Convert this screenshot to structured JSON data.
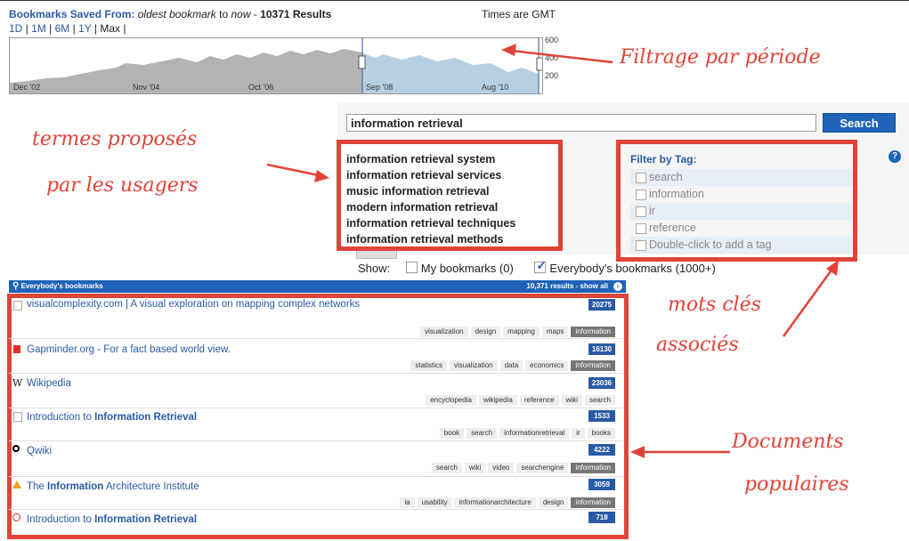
{
  "header": {
    "prefix": "Bookmarks Saved From:",
    "range_text": "oldest bookmark",
    "mid": "to",
    "now": "now",
    "dash": "-",
    "results": "10371 Results",
    "times": "Times are GMT"
  },
  "ranges": [
    "1D",
    "1M",
    "6M",
    "1Y",
    "Max"
  ],
  "timeline": {
    "y_ticks": [
      "600",
      "400",
      "200"
    ],
    "x_ticks": [
      "Dec '02",
      "Nov '04",
      "Oct '06",
      "Sep '08",
      "Aug '10"
    ]
  },
  "search": {
    "value": "information retrieval",
    "button": "Search"
  },
  "suggestions": [
    "information retrieval system",
    "information retrieval services",
    "music information retrieval",
    "modern information retrieval",
    "information retrieval techniques",
    "information retrieval methods"
  ],
  "filter": {
    "title": "Filter by Tag:",
    "help": "?",
    "tags": [
      "search",
      "information",
      "ir",
      "reference",
      "Double-click to add a tag"
    ]
  },
  "show": {
    "label": "Show:",
    "mine": "My bookmarks (0)",
    "everyone": "Everybody's bookmarks (1000+)"
  },
  "results_bar": {
    "title": "Everybody's bookmarks",
    "count": "10,371 results - show all"
  },
  "results": [
    {
      "title": "visualcomplexity.com | A visual exploration on mapping complex networks",
      "count": "20275",
      "tags": [
        "visualization",
        "design",
        "mapping",
        "maps",
        "information"
      ]
    },
    {
      "title": "Gapminder.org - For a fact based world view.",
      "count": "16130",
      "tags": [
        "statistics",
        "visualization",
        "data",
        "economics",
        "information"
      ]
    },
    {
      "title": "Wikipedia",
      "count": "23036",
      "tags": [
        "encyclopedia",
        "wikipedia",
        "reference",
        "wiki",
        "search"
      ]
    },
    {
      "title_a": "Introduction to ",
      "title_b": "Information Retrieval",
      "count": "1533",
      "tags": [
        "book",
        "search",
        "informationretrieval",
        "ir",
        "books"
      ]
    },
    {
      "title": "Qwiki",
      "count": "4222",
      "tags": [
        "search",
        "wiki",
        "video",
        "searchengine",
        "information"
      ]
    },
    {
      "title_a": "The ",
      "title_b": "Information",
      "title_c": " Architecture Institute",
      "count": "3059",
      "tags": [
        "ia",
        "usability",
        "informationarchitecture",
        "design",
        "information"
      ]
    },
    {
      "title_a": "Introduction to ",
      "title_b": "Information Retrieval",
      "count": "718"
    }
  ],
  "annotations": {
    "filter": "Filtrage par période",
    "terms1": "termes proposés",
    "terms2": "par les usagers",
    "kw1": "mots clés",
    "kw2": "associés",
    "docs1": "Documents",
    "docs2": "populaires"
  },
  "colors": {
    "accent": "#e04438",
    "link": "#2a5aa5",
    "button": "#1f63b8"
  }
}
